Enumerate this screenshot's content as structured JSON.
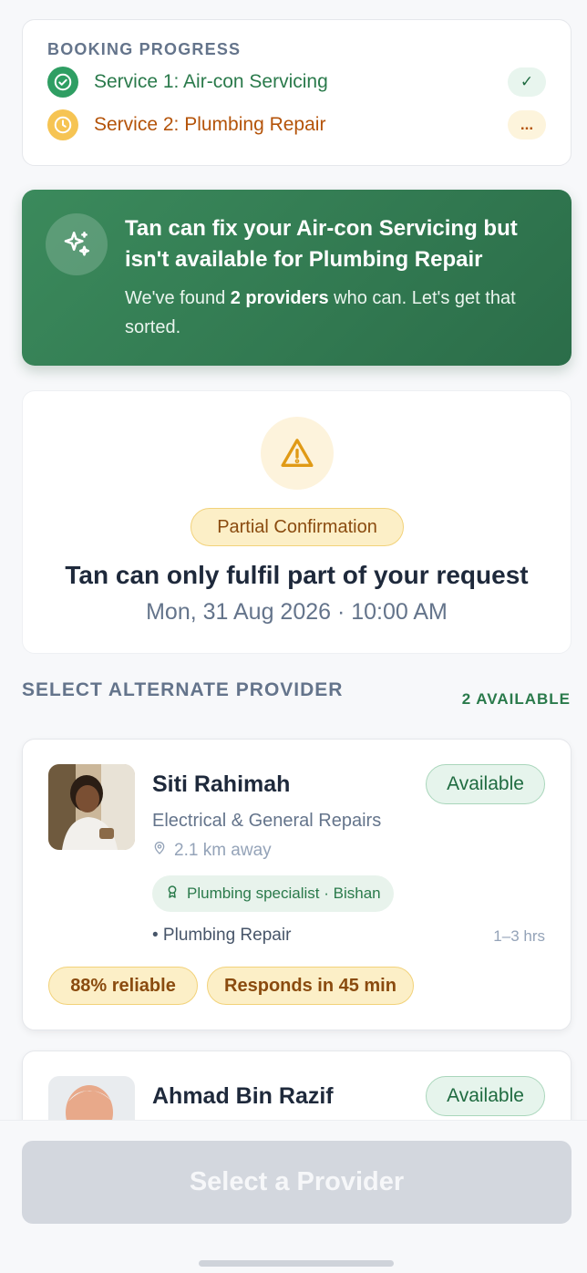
{
  "progress": {
    "title": "BOOKING PROGRESS",
    "steps": [
      {
        "label": "Service 1: Air-con Servicing",
        "status": "✓",
        "state": "done"
      },
      {
        "label": "Service 2: Plumbing Repair",
        "status": "...",
        "state": "pending"
      }
    ]
  },
  "banner": {
    "title": "Tan can fix your Air-con Servicing but isn't available for Plumbing Repair",
    "text_before": "We've found ",
    "text_bold": "2 providers",
    "text_after": " who can. Let's get that sorted."
  },
  "confirmation": {
    "badge": "Partial Confirmation",
    "title": "Tan can only fulfil part of your request",
    "datetime": "Mon, 31 Aug 2026 · 10:00 AM"
  },
  "section": {
    "title": "SELECT ALTERNATE PROVIDER",
    "count": "2 AVAILABLE"
  },
  "providers": [
    {
      "name": "Siti Rahimah",
      "availability": "Available",
      "category": "Electrical & General Repairs",
      "distance": "2.1 km away",
      "specialty": "Plumbing specialist · Bishan",
      "service": "• Plumbing Repair",
      "duration": "1–3 hrs",
      "reliability": "88% reliable",
      "response": "Responds in 45 min"
    },
    {
      "name": "Ahmad Bin Razif",
      "availability": "Available"
    }
  ],
  "cta": {
    "label": "Select a Provider"
  },
  "colors": {
    "primary_green": "#2b6d49",
    "warning": "#f6c453",
    "disabled": "#d3d7de"
  }
}
